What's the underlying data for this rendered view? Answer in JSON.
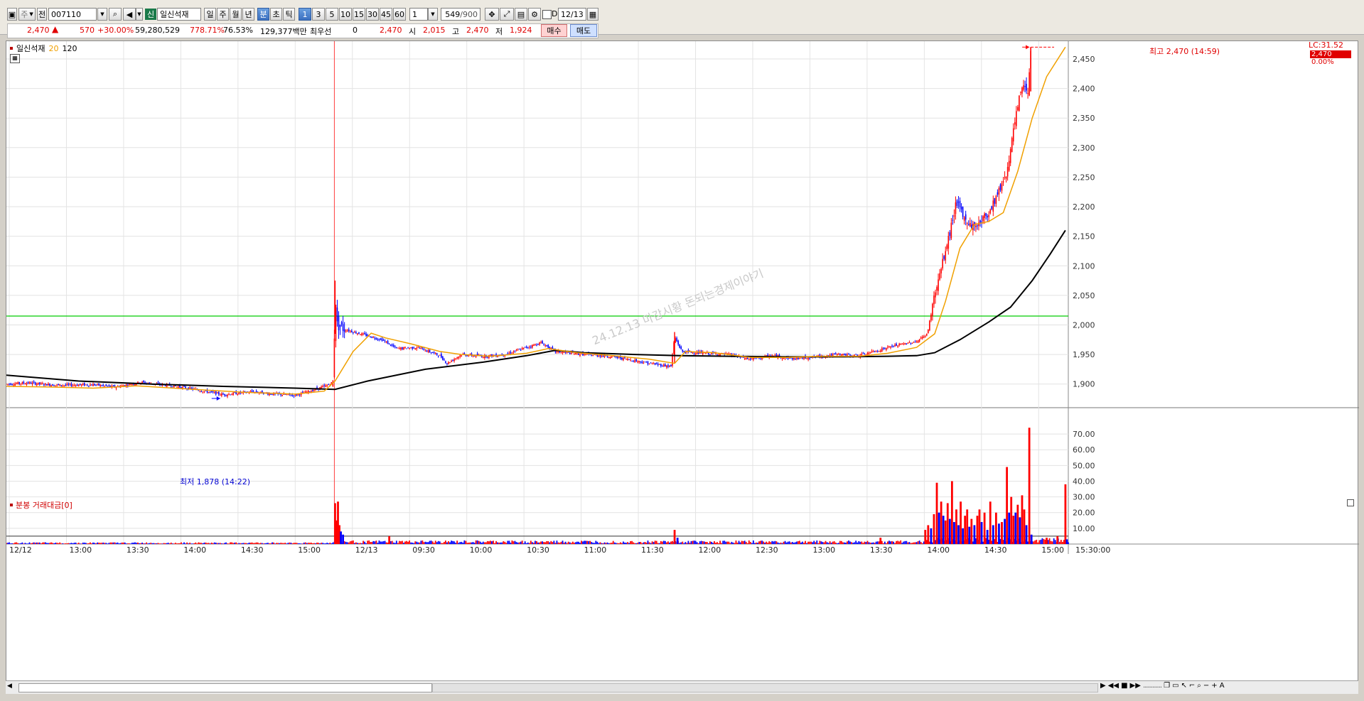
{
  "toolbar": {
    "market_code": "주",
    "prefix": "전",
    "code": "007110",
    "badge": "신",
    "name": "일신석재",
    "periods": [
      "일",
      "주",
      "월",
      "년",
      "분",
      "초",
      "틱"
    ],
    "selected_period": "분",
    "intervals": [
      "1",
      "3",
      "5",
      "10",
      "15",
      "30",
      "45",
      "60"
    ],
    "selected_interval": "1",
    "count_select": "1",
    "count": "549",
    "count_max": "/900",
    "date": "12/13",
    "checkbox_d_label": "D"
  },
  "quote": {
    "price": "2,470",
    "change": "570",
    "change_pct": "+30.00%",
    "volume": "59,280,529",
    "volume_ratio": "778.71%",
    "turnover": "76.53%",
    "amount": "129,377백만",
    "pref_label": "최우선",
    "pref_value": "0",
    "pref_price": "2,470",
    "open_label": "시",
    "open": "2,015",
    "high_label": "고",
    "high": "2,470",
    "low_label": "저",
    "low": "1,924",
    "buy_label": "매수",
    "sell_label": "매도"
  },
  "price_panel": {
    "legend_name": "일신석재",
    "legend_ma1": "20",
    "legend_ma2": "120",
    "lc_label": "LC:31.52",
    "last_price_tag": "2,470",
    "last_pct_tag": "0.00%",
    "high_annotation": "최고 2,470 (14:59)",
    "low_annotation": "최저 1,878 (14:22)",
    "watermark": "24.12.13 마감시황 돈되는경제이야기"
  },
  "volume_panel": {
    "title": "분봉 거래대금[0]"
  },
  "colors": {
    "up": "#ff0000",
    "down": "#0000ff",
    "ma20": "#f0a000",
    "ma120": "#000000",
    "support_line": "#00cc00",
    "day_divider": "#ff4040"
  },
  "chart_data": [
    {
      "type": "candlestick",
      "name": "일신석재 1분봉",
      "ylim": [
        1860,
        2480
      ],
      "yticks": [
        1900,
        1950,
        2000,
        2050,
        2100,
        2150,
        2200,
        2250,
        2300,
        2350,
        2400,
        2450
      ],
      "ytick_labels": [
        "1,900",
        "1,950",
        "2,000",
        "2,050",
        "2,100",
        "2,150",
        "2,200",
        "2,250",
        "2,300",
        "2,350",
        "2,400",
        "2,450"
      ],
      "xtick_labels": [
        "12/12",
        "13:00",
        "13:30",
        "14:00",
        "14:30",
        "15:00",
        "12/13",
        "09:30",
        "10:00",
        "10:30",
        "11:00",
        "11:30",
        "12:00",
        "12:30",
        "13:00",
        "13:30",
        "14:00",
        "14:30",
        "15:00",
        "15:30:00"
      ],
      "support_level": 2015,
      "price_path": [
        [
          0,
          1900
        ],
        [
          30,
          1902
        ],
        [
          70,
          1898
        ],
        [
          120,
          1899
        ],
        [
          150,
          1895
        ],
        [
          185,
          1903
        ],
        [
          230,
          1897
        ],
        [
          270,
          1889
        ],
        [
          300,
          1882
        ],
        [
          340,
          1887
        ],
        [
          370,
          1883
        ],
        [
          400,
          1881
        ],
        [
          420,
          1888
        ],
        [
          445,
          1898
        ],
        [
          453,
          1904
        ],
        [
          455,
          2060
        ],
        [
          458,
          2000
        ],
        [
          470,
          1992
        ],
        [
          490,
          1985
        ],
        [
          520,
          1975
        ],
        [
          540,
          1960
        ],
        [
          570,
          1962
        ],
        [
          600,
          1948
        ],
        [
          610,
          1935
        ],
        [
          630,
          1950
        ],
        [
          660,
          1947
        ],
        [
          690,
          1950
        ],
        [
          720,
          1962
        ],
        [
          740,
          1970
        ],
        [
          760,
          1955
        ],
        [
          800,
          1950
        ],
        [
          830,
          1948
        ],
        [
          860,
          1942
        ],
        [
          890,
          1935
        ],
        [
          920,
          1930
        ],
        [
          925,
          1980
        ],
        [
          935,
          1955
        ],
        [
          970,
          1952
        ],
        [
          1000,
          1950
        ],
        [
          1030,
          1942
        ],
        [
          1060,
          1948
        ],
        [
          1090,
          1943
        ],
        [
          1120,
          1946
        ],
        [
          1150,
          1950
        ],
        [
          1180,
          1948
        ],
        [
          1200,
          1955
        ],
        [
          1230,
          1965
        ],
        [
          1260,
          1972
        ],
        [
          1275,
          1985
        ],
        [
          1283,
          2040
        ],
        [
          1295,
          2100
        ],
        [
          1305,
          2150
        ],
        [
          1315,
          2210
        ],
        [
          1325,
          2180
        ],
        [
          1340,
          2165
        ],
        [
          1360,
          2190
        ],
        [
          1375,
          2230
        ],
        [
          1385,
          2260
        ],
        [
          1393,
          2320
        ],
        [
          1400,
          2370
        ],
        [
          1407,
          2410
        ],
        [
          1414,
          2395
        ],
        [
          1418,
          2470
        ]
      ],
      "ma20_path": [
        [
          0,
          1896
        ],
        [
          60,
          1895
        ],
        [
          120,
          1893
        ],
        [
          180,
          1897
        ],
        [
          260,
          1891
        ],
        [
          330,
          1886
        ],
        [
          400,
          1883
        ],
        [
          440,
          1888
        ],
        [
          455,
          1905
        ],
        [
          480,
          1955
        ],
        [
          505,
          1986
        ],
        [
          525,
          1978
        ],
        [
          560,
          1968
        ],
        [
          600,
          1955
        ],
        [
          630,
          1950
        ],
        [
          670,
          1947
        ],
        [
          720,
          1952
        ],
        [
          750,
          1960
        ],
        [
          790,
          1953
        ],
        [
          840,
          1948
        ],
        [
          890,
          1942
        ],
        [
          925,
          1935
        ],
        [
          940,
          1955
        ],
        [
          980,
          1953
        ],
        [
          1030,
          1945
        ],
        [
          1080,
          1945
        ],
        [
          1130,
          1947
        ],
        [
          1180,
          1947
        ],
        [
          1220,
          1952
        ],
        [
          1260,
          1962
        ],
        [
          1285,
          1985
        ],
        [
          1300,
          2040
        ],
        [
          1320,
          2130
        ],
        [
          1340,
          2170
        ],
        [
          1360,
          2175
        ],
        [
          1380,
          2190
        ],
        [
          1400,
          2260
        ],
        [
          1420,
          2350
        ],
        [
          1440,
          2420
        ],
        [
          1466,
          2470
        ]
      ],
      "ma120_path": [
        [
          0,
          1915
        ],
        [
          100,
          1905
        ],
        [
          200,
          1900
        ],
        [
          300,
          1896
        ],
        [
          400,
          1893
        ],
        [
          455,
          1891
        ],
        [
          500,
          1905
        ],
        [
          580,
          1925
        ],
        [
          660,
          1937
        ],
        [
          720,
          1948
        ],
        [
          760,
          1957
        ],
        [
          800,
          1953
        ],
        [
          870,
          1950
        ],
        [
          930,
          1948
        ],
        [
          1000,
          1947
        ],
        [
          1080,
          1946
        ],
        [
          1160,
          1946
        ],
        [
          1220,
          1947
        ],
        [
          1260,
          1948
        ],
        [
          1285,
          1953
        ],
        [
          1320,
          1975
        ],
        [
          1360,
          2005
        ],
        [
          1390,
          2030
        ],
        [
          1420,
          2075
        ],
        [
          1445,
          2120
        ],
        [
          1466,
          2160
        ]
      ],
      "high_point": {
        "index": 1418,
        "value": 2470,
        "label": "최고 2,470 (14:59)"
      },
      "low_point": {
        "index": 292,
        "value": 1878,
        "label": "최저 1,878 (14:22)"
      }
    },
    {
      "type": "bar",
      "name": "분봉 거래대금",
      "ylim": [
        0,
        75
      ],
      "yticks": [
        10,
        20,
        30,
        40,
        50,
        60,
        70
      ],
      "ytick_labels": [
        "10.00",
        "20.00",
        "30.00",
        "40.00",
        "50.00",
        "60.00",
        "70.00"
      ],
      "threshold_line": 5,
      "spikes": [
        {
          "index": 455,
          "value": 26,
          "up": true
        },
        {
          "index": 457,
          "value": 15,
          "up": true
        },
        {
          "index": 459,
          "value": 27,
          "up": true
        },
        {
          "index": 461,
          "value": 12,
          "up": true
        },
        {
          "index": 463,
          "value": 8,
          "up": false
        },
        {
          "index": 466,
          "value": 6,
          "up": false
        },
        {
          "index": 530,
          "value": 5,
          "up": true
        },
        {
          "index": 925,
          "value": 9,
          "up": true
        },
        {
          "index": 929,
          "value": 4,
          "up": false
        },
        {
          "index": 1210,
          "value": 4,
          "up": true
        },
        {
          "index": 1272,
          "value": 9,
          "up": true
        },
        {
          "index": 1276,
          "value": 12,
          "up": true
        },
        {
          "index": 1280,
          "value": 10,
          "up": false
        },
        {
          "index": 1284,
          "value": 19,
          "up": true
        },
        {
          "index": 1288,
          "value": 39,
          "up": true
        },
        {
          "index": 1291,
          "value": 20,
          "up": false
        },
        {
          "index": 1294,
          "value": 27,
          "up": true
        },
        {
          "index": 1297,
          "value": 18,
          "up": false
        },
        {
          "index": 1300,
          "value": 15,
          "up": true
        },
        {
          "index": 1303,
          "value": 26,
          "up": true
        },
        {
          "index": 1306,
          "value": 16,
          "up": false
        },
        {
          "index": 1309,
          "value": 40,
          "up": true
        },
        {
          "index": 1312,
          "value": 14,
          "up": false
        },
        {
          "index": 1315,
          "value": 22,
          "up": true
        },
        {
          "index": 1318,
          "value": 12,
          "up": false
        },
        {
          "index": 1321,
          "value": 27,
          "up": true
        },
        {
          "index": 1324,
          "value": 10,
          "up": false
        },
        {
          "index": 1327,
          "value": 18,
          "up": true
        },
        {
          "index": 1330,
          "value": 22,
          "up": true
        },
        {
          "index": 1333,
          "value": 11,
          "up": false
        },
        {
          "index": 1336,
          "value": 16,
          "up": true
        },
        {
          "index": 1340,
          "value": 12,
          "up": false
        },
        {
          "index": 1344,
          "value": 18,
          "up": true
        },
        {
          "index": 1347,
          "value": 22,
          "up": true
        },
        {
          "index": 1350,
          "value": 14,
          "up": false
        },
        {
          "index": 1354,
          "value": 20,
          "up": true
        },
        {
          "index": 1358,
          "value": 9,
          "up": false
        },
        {
          "index": 1362,
          "value": 27,
          "up": true
        },
        {
          "index": 1366,
          "value": 12,
          "up": false
        },
        {
          "index": 1370,
          "value": 20,
          "up": true
        },
        {
          "index": 1374,
          "value": 13,
          "up": false
        },
        {
          "index": 1378,
          "value": 14,
          "up": true
        },
        {
          "index": 1382,
          "value": 16,
          "up": false
        },
        {
          "index": 1385,
          "value": 49,
          "up": true
        },
        {
          "index": 1388,
          "value": 20,
          "up": false
        },
        {
          "index": 1391,
          "value": 30,
          "up": true
        },
        {
          "index": 1394,
          "value": 18,
          "up": true
        },
        {
          "index": 1397,
          "value": 20,
          "up": false
        },
        {
          "index": 1400,
          "value": 25,
          "up": true
        },
        {
          "index": 1403,
          "value": 17,
          "up": false
        },
        {
          "index": 1406,
          "value": 31,
          "up": true
        },
        {
          "index": 1409,
          "value": 22,
          "up": true
        },
        {
          "index": 1412,
          "value": 12,
          "up": false
        },
        {
          "index": 1416,
          "value": 74,
          "up": true
        },
        {
          "index": 1419,
          "value": 6,
          "up": false
        },
        {
          "index": 1440,
          "value": 4,
          "up": true
        },
        {
          "index": 1455,
          "value": 5,
          "up": true
        },
        {
          "index": 1466,
          "value": 38,
          "up": true
        },
        {
          "index": 1468,
          "value": 3,
          "up": false
        }
      ]
    }
  ]
}
